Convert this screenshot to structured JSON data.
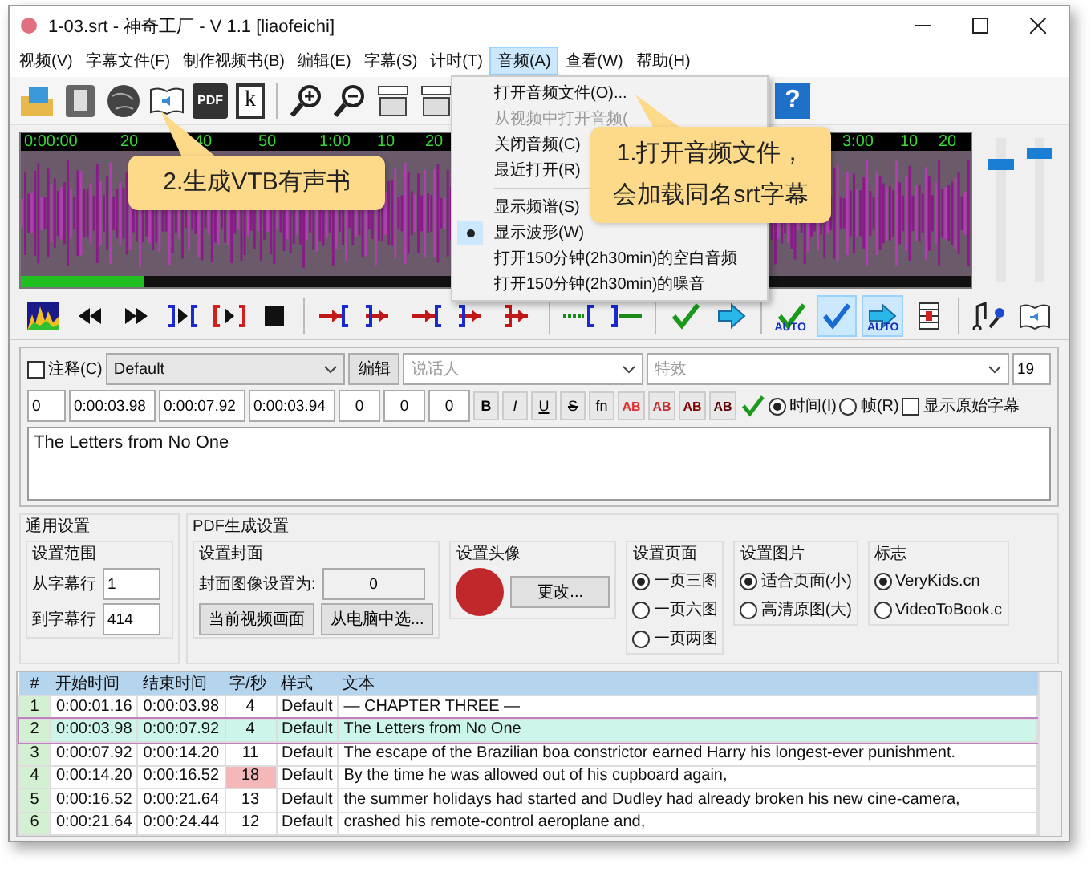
{
  "window": {
    "title": "1-03.srt - 神奇工厂 - V 1.1 [liaofeichi]"
  },
  "menu_bar": [
    {
      "label": "视频(V)",
      "selected": false
    },
    {
      "label": "字幕文件(F)",
      "selected": false
    },
    {
      "label": "制作视频书(B)",
      "selected": false
    },
    {
      "label": "编辑(E)",
      "selected": false
    },
    {
      "label": "字幕(S)",
      "selected": false
    },
    {
      "label": "计时(T)",
      "selected": false
    },
    {
      "label": "音频(A)",
      "selected": true
    },
    {
      "label": "查看(W)",
      "selected": false
    },
    {
      "label": "帮助(H)",
      "selected": false
    }
  ],
  "toolbar": [
    {
      "kind": "open-video"
    },
    {
      "kind": "phone"
    },
    {
      "kind": "globe"
    },
    {
      "kind": "audiobook"
    },
    {
      "kind": "pdf",
      "label": "PDF"
    },
    {
      "kind": "kindle",
      "label": "k"
    },
    {
      "kind": "zoom-in"
    },
    {
      "kind": "zoom-out"
    },
    {
      "kind": "caption"
    },
    {
      "kind": "caption"
    },
    {
      "kind": "help",
      "label": "?"
    }
  ],
  "audio_menu": {
    "items": [
      {
        "kind": "item",
        "label": "打开音频文件(O)...",
        "disabled": false,
        "checked": false
      },
      {
        "kind": "item",
        "label": "从视频中打开音频(",
        "disabled": true,
        "checked": false
      },
      {
        "kind": "item",
        "label": "关闭音频(C)",
        "disabled": false,
        "checked": false
      },
      {
        "kind": "item",
        "label": "最近打开(R)",
        "disabled": false,
        "checked": false
      },
      {
        "kind": "separator"
      },
      {
        "kind": "item",
        "label": "显示频谱(S)",
        "disabled": false,
        "checked": false
      },
      {
        "kind": "item",
        "label": "显示波形(W)",
        "disabled": false,
        "checked": true
      },
      {
        "kind": "item",
        "label": "打开150分钟(2h30min)的空白音频",
        "disabled": false,
        "checked": false
      },
      {
        "kind": "item",
        "label": "打开150分钟(2h30min)的噪音",
        "disabled": false,
        "checked": false
      }
    ]
  },
  "waveform": {
    "ruler": [
      "0:00:00",
      "20",
      "40",
      "50",
      "1:00",
      "10",
      "20",
      "3:00",
      "10",
      "20"
    ],
    "position": {
      "level": 0.13
    },
    "volume": [
      {
        "level": 0.85
      },
      {
        "level": 0.93
      }
    ]
  },
  "controls": [
    {
      "kind": "spectrum",
      "selected": false
    },
    {
      "kind": "rewind",
      "selected": false
    },
    {
      "kind": "forward",
      "selected": false
    },
    {
      "kind": "play-between",
      "selected": false
    },
    {
      "kind": "play-inside",
      "selected": false
    },
    {
      "kind": "stop",
      "selected": false
    },
    {
      "kind": "set-start",
      "selected": false
    },
    {
      "kind": "set-end",
      "selected": false
    },
    {
      "kind": "set-start",
      "selected": false
    },
    {
      "kind": "set-end",
      "selected": false
    },
    {
      "kind": "play-fast",
      "selected": false
    },
    {
      "kind": "extend-start",
      "selected": false
    },
    {
      "kind": "extend-end",
      "selected": false
    },
    {
      "kind": "check",
      "selected": false
    },
    {
      "kind": "next",
      "selected": false
    },
    {
      "kind": "check",
      "label": "AUTO",
      "selected": false
    },
    {
      "kind": "check-blue",
      "selected": true
    },
    {
      "kind": "next",
      "label": "AUTO",
      "selected": true
    },
    {
      "kind": "film",
      "selected": false
    },
    {
      "kind": "mic",
      "selected": false
    },
    {
      "kind": "audiobook",
      "selected": false
    }
  ],
  "editor": {
    "comment": {
      "label": "注释(C)",
      "checked": false
    },
    "style": "Default",
    "edit_button": "编辑",
    "actor": {
      "placeholder": "说话人"
    },
    "effect": {
      "placeholder": "特效"
    },
    "count": "19",
    "layer": "0",
    "start": "0:00:03.98",
    "end": "0:00:07.92",
    "duration": "0:00:03.94",
    "margins": [
      "0",
      "0",
      "0"
    ],
    "format_buttons": [
      {
        "kind": "bold",
        "label": "B"
      },
      {
        "kind": "italic",
        "label": "I"
      },
      {
        "kind": "underline",
        "label": "U"
      },
      {
        "kind": "strike",
        "label": "S"
      },
      {
        "kind": "font",
        "label": "fn"
      }
    ],
    "color_buttons": [
      {
        "label": "AB",
        "color": "#e03030"
      },
      {
        "label": "AB",
        "color": "#c03030"
      },
      {
        "label": "AB",
        "color": "#800000"
      },
      {
        "label": "AB",
        "color": "#600000"
      }
    ],
    "mode": [
      {
        "label": "时间(I)",
        "selected": true
      },
      {
        "label": "帧(R)",
        "selected": false
      }
    ],
    "show_original": {
      "label": "显示原始字幕",
      "checked": false
    },
    "text": "The Letters from No One"
  },
  "settings": {
    "general": {
      "title": "通用设置",
      "range_title": "设置范围",
      "from_label": "从字幕行",
      "from": "1",
      "to_label": "到字幕行",
      "to": "414"
    },
    "pdf": {
      "title": "PDF生成设置",
      "cover": {
        "title": "设置封面",
        "label": "封面图像设置为:",
        "value": "0",
        "buttons": [
          "当前视频画面",
          "从电脑中选..."
        ]
      },
      "avatar": {
        "title": "设置头像",
        "button": "更改..."
      },
      "groups": [
        {
          "title": "设置页面",
          "options": [
            {
              "label": "一页三图",
              "selected": true
            },
            {
              "label": "一页六图",
              "selected": false
            },
            {
              "label": "一页两图",
              "selected": false
            }
          ]
        },
        {
          "title": "设置图片",
          "options": [
            {
              "label": "适合页面(小)",
              "selected": true
            },
            {
              "label": "高清原图(大)",
              "selected": false
            }
          ]
        },
        {
          "title": "标志",
          "options": [
            {
              "label": "VeryKids.cn",
              "selected": true
            },
            {
              "label": "VideoToBook.c",
              "selected": false
            }
          ]
        }
      ]
    }
  },
  "table": {
    "columns": [
      "#",
      "开始时间",
      "结束时间",
      "字/秒",
      "样式",
      "文本"
    ],
    "rows": [
      {
        "cells": [
          "1",
          "0:00:01.16",
          "0:00:03.98",
          "4",
          "Default",
          "— CHAPTER THREE —"
        ],
        "selected": false,
        "cps_warning": false
      },
      {
        "cells": [
          "2",
          "0:00:03.98",
          "0:00:07.92",
          "4",
          "Default",
          "The Letters from No One"
        ],
        "selected": true,
        "cps_warning": false
      },
      {
        "cells": [
          "3",
          "0:00:07.92",
          "0:00:14.20",
          "11",
          "Default",
          "The escape of the Brazilian boa constrictor earned Harry his longest-ever punishment."
        ],
        "selected": false,
        "cps_warning": false
      },
      {
        "cells": [
          "4",
          "0:00:14.20",
          "0:00:16.52",
          "18",
          "Default",
          "By the time he was allowed out of his cupboard again,"
        ],
        "selected": false,
        "cps_warning": true
      },
      {
        "cells": [
          "5",
          "0:00:16.52",
          "0:00:21.64",
          "13",
          "Default",
          "the summer holidays had started and Dudley had already broken his new cine-camera,"
        ],
        "selected": false,
        "cps_warning": false
      },
      {
        "cells": [
          "6",
          "0:00:21.64",
          "0:00:24.44",
          "12",
          "Default",
          "crashed his remote-control aeroplane and,"
        ],
        "selected": false,
        "cps_warning": false
      }
    ]
  },
  "callouts": [
    {
      "lines": [
        "2.生成VTB有声书"
      ]
    },
    {
      "lines": [
        "1.打开音频文件，",
        "会加载同名srt字幕"
      ]
    }
  ]
}
